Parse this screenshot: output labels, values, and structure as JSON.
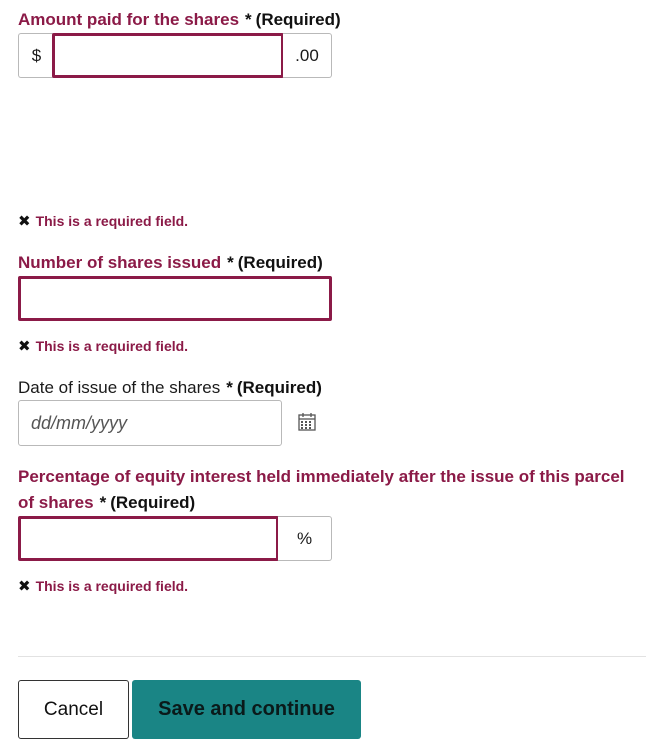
{
  "form": {
    "amount": {
      "label": "Amount paid for the shares",
      "star": "*",
      "required": "(Required)",
      "prefix": "$",
      "suffix": ".00",
      "value": "",
      "error": "This is a required field."
    },
    "shares": {
      "label": "Number of shares issued",
      "star": "*",
      "required": "(Required)",
      "value": "",
      "error": "This is a required field."
    },
    "date": {
      "label": "Date of issue of the shares",
      "star": "*",
      "required": "(Required)",
      "placeholder": "dd/mm/yyyy"
    },
    "percentage": {
      "label_line1": "Percentage of equity interest held immediately after the issue of this parcel",
      "label_line2": "of shares",
      "star": "*",
      "required": "(Required)",
      "suffix": "%",
      "value": "",
      "error": "This is a required field."
    }
  },
  "icons": {
    "error": "✖",
    "calendar": "calendar-icon"
  },
  "actions": {
    "cancel": "Cancel",
    "save": "Save and continue"
  },
  "colors": {
    "error": "#8b1a47",
    "primary": "#1a8585"
  }
}
